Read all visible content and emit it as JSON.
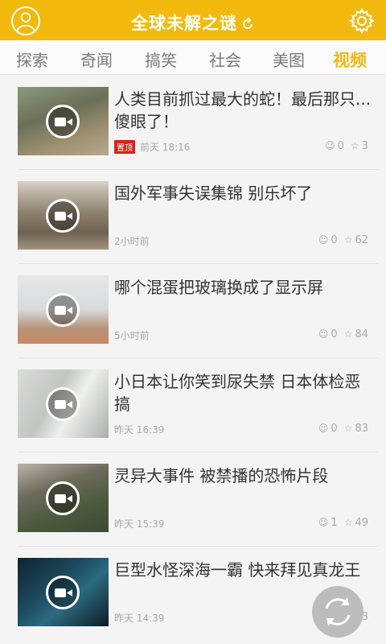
{
  "header": {
    "title": "全球未解之谜"
  },
  "tabs": [
    {
      "label": "探索"
    },
    {
      "label": "奇闻"
    },
    {
      "label": "搞笑"
    },
    {
      "label": "社会"
    },
    {
      "label": "美图"
    },
    {
      "label": "视频"
    }
  ],
  "active_tab": "视频",
  "items": [
    {
      "title": "人类目前抓过最大的蛇！最后那只...傻眼了！",
      "badge": "置顶",
      "time": "前天 18:16",
      "comments": "0",
      "favorites": "3"
    },
    {
      "title": "国外军事失误集锦 别乐坏了",
      "time": "2小时前",
      "comments": "0",
      "favorites": "62"
    },
    {
      "title": "哪个混蛋把玻璃换成了显示屏",
      "time": "5小时前",
      "comments": "0",
      "favorites": "84"
    },
    {
      "title": "小日本让你笑到尿失禁 日本体检恶搞",
      "time": "昨天 16:39",
      "comments": "0",
      "favorites": "83"
    },
    {
      "title": "灵异大事件 被禁播的恐怖片段",
      "time": "昨天 15:39",
      "comments": "1",
      "favorites": "49"
    },
    {
      "title": "巨型水怪深海一霸 快来拜见真龙王",
      "time": "昨天 14:39",
      "comments": "",
      "favorites": "3"
    }
  ],
  "colors": {
    "brand": "#f2b90f",
    "badge": "#d9231c"
  },
  "icons": [
    "avatar-icon",
    "gear-icon",
    "refresh-icon",
    "play-icon",
    "comment-icon",
    "star-icon"
  ]
}
